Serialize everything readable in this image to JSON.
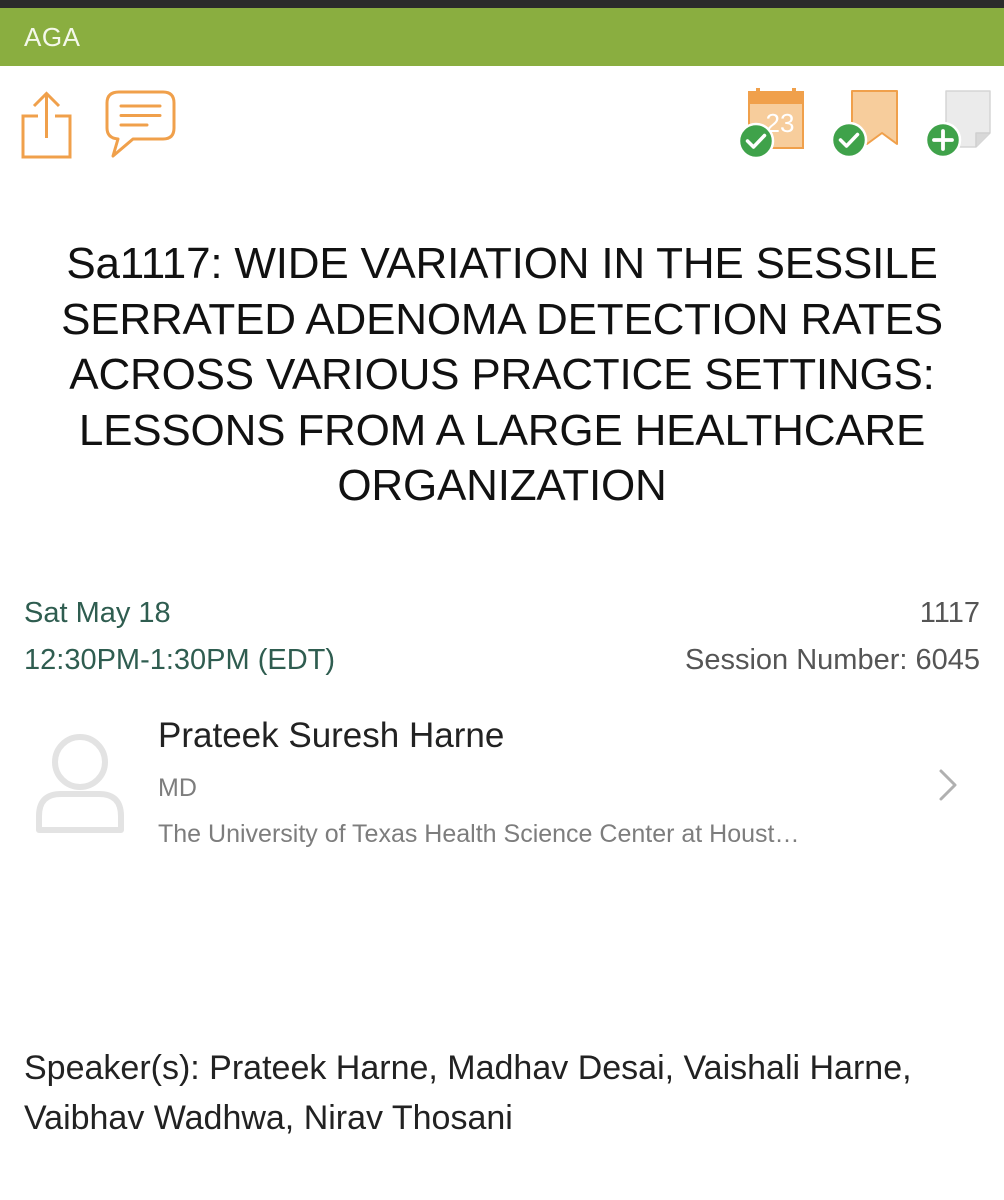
{
  "app": {
    "title": "AGA"
  },
  "toolbar": {
    "left_icons": [
      "share-icon",
      "comment-icon"
    ],
    "right_icons": [
      "calendar-added-icon",
      "bookmark-added-icon",
      "note-add-icon"
    ],
    "calendar_day": "23",
    "accent_color": "#f0a04b",
    "check_color": "#3fa24a",
    "brand_color": "#8aae40"
  },
  "session": {
    "title": "Sa1117: WIDE VARIATION IN THE SESSILE SERRATED ADENOMA DETECTION RATES ACROSS VARIOUS PRACTICE SETTINGS: LESSONS FROM A LARGE HEALTHCARE ORGANIZATION",
    "date": "Sat May 18",
    "time": "12:30PM-1:30PM (EDT)",
    "abstract_number": "1117",
    "session_number": "Session Number: 6045"
  },
  "presenter": {
    "name": "Prateek Suresh Harne",
    "degree": "MD",
    "organization": "The University of Texas Health Science Center at Houst…"
  },
  "speakers": {
    "text": "Speaker(s): Prateek Harne, Madhav Desai, Vaishali Harne, Vaibhav Wadhwa, Nirav Thosani"
  }
}
